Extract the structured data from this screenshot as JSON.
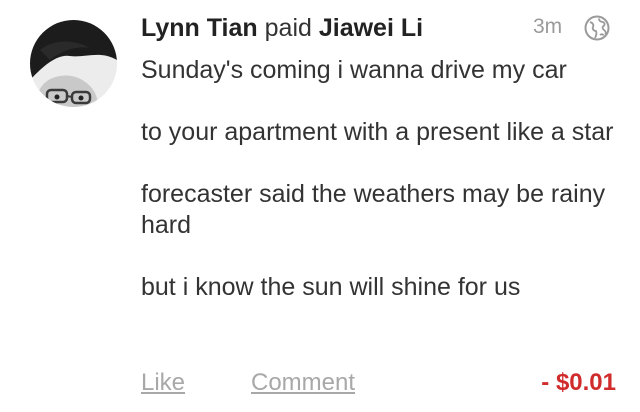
{
  "story": {
    "actor": "Lynn Tian",
    "verb": "paid",
    "target": "Jiawei Li",
    "time": "3m",
    "privacy_icon": "globe-icon",
    "message_paragraphs": [
      "Sunday's coming i wanna drive my car",
      "to your apartment with a present like a star",
      "forecaster said the weathers may be rainy hard",
      "but i know the sun will shine for us"
    ],
    "amount": "- $0.01",
    "amount_color": "#d02c2c"
  },
  "actions": {
    "like_label": "Like",
    "comment_label": "Comment"
  }
}
